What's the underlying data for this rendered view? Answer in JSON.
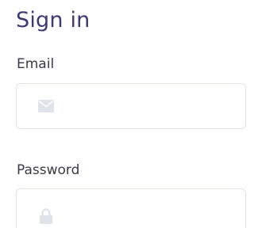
{
  "form": {
    "title": "Sign in",
    "email": {
      "label": "Email",
      "value": "",
      "placeholder": "",
      "icon": "envelope-icon"
    },
    "password": {
      "label": "Password",
      "value": "",
      "placeholder": "",
      "icon": "lock-icon"
    }
  },
  "colors": {
    "title": "#3b3a72",
    "label": "#3a3a4a",
    "field_border": "#dfe3ea",
    "icon": "#dfe3ea"
  }
}
